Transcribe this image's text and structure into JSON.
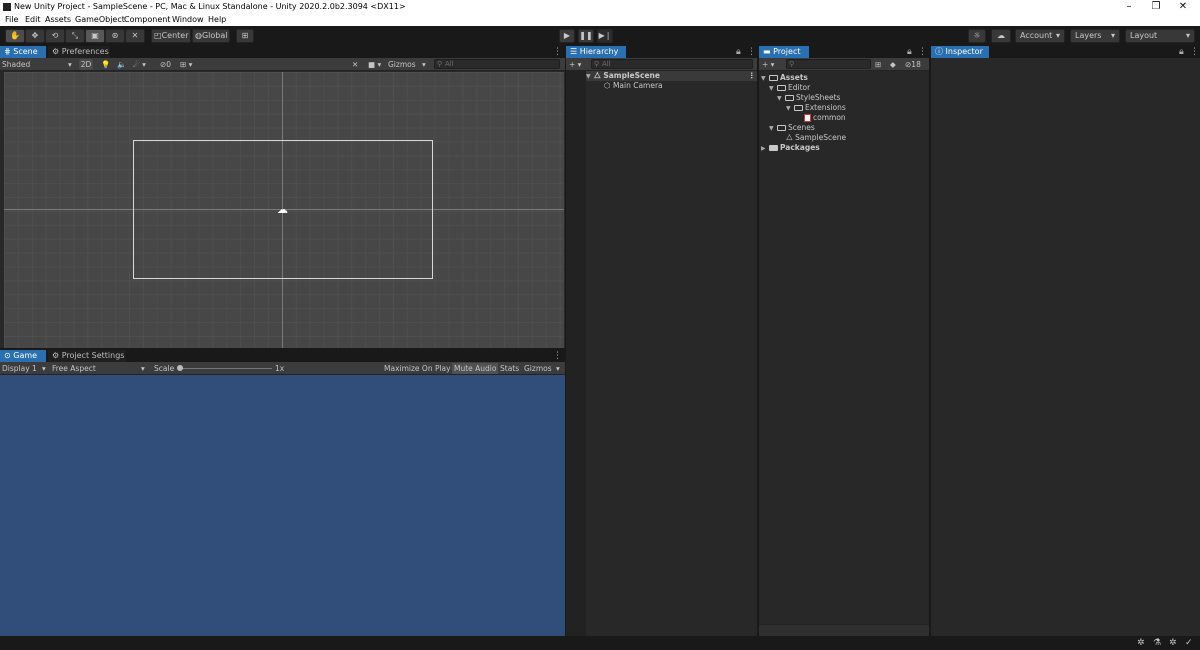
{
  "window": {
    "title": "New Unity Project - SampleScene - PC, Mac & Linux Standalone - Unity 2020.2.0b2.3094 <DX11>",
    "minimize": "–",
    "maximize": "❐",
    "close": "✕"
  },
  "menu": [
    "File",
    "Edit",
    "Assets",
    "GameObject",
    "Component",
    "Window",
    "Help"
  ],
  "toolbar": {
    "pivot": "Center",
    "space": "Global",
    "account": "Account",
    "layers": "Layers",
    "layout": "Layout"
  },
  "scene_panel": {
    "tabs": [
      "Scene",
      "Preferences"
    ],
    "shading": "Shaded",
    "mode2d": "2D",
    "hidden_count": "0",
    "gizmos": "Gizmos",
    "search_placeholder": "All"
  },
  "game_panel": {
    "tabs": [
      "Game",
      "Project Settings"
    ],
    "display": "Display 1",
    "aspect": "Free Aspect",
    "scale_label": "Scale",
    "scale_value": "1x",
    "maximize": "Maximize On Play",
    "mute": "Mute Audio",
    "stats": "Stats",
    "gizmos": "Gizmos",
    "background_color": "#314d79"
  },
  "hierarchy": {
    "tab": "Hierarchy",
    "search_placeholder": "All",
    "items": [
      {
        "label": "SampleScene"
      },
      {
        "label": "Main Camera"
      }
    ]
  },
  "project": {
    "tab": "Project",
    "hidden_count": "18",
    "tree": [
      {
        "label": "Assets"
      },
      {
        "label": "Editor"
      },
      {
        "label": "StyleSheets"
      },
      {
        "label": "Extensions"
      },
      {
        "label": "common"
      },
      {
        "label": "Scenes"
      },
      {
        "label": "SampleScene"
      },
      {
        "label": "Packages"
      }
    ]
  },
  "inspector": {
    "tab": "Inspector"
  },
  "colors": {
    "accent_tab": "#2a6fb0",
    "panel_bg": "#282828",
    "scene_bg": "#474747"
  }
}
